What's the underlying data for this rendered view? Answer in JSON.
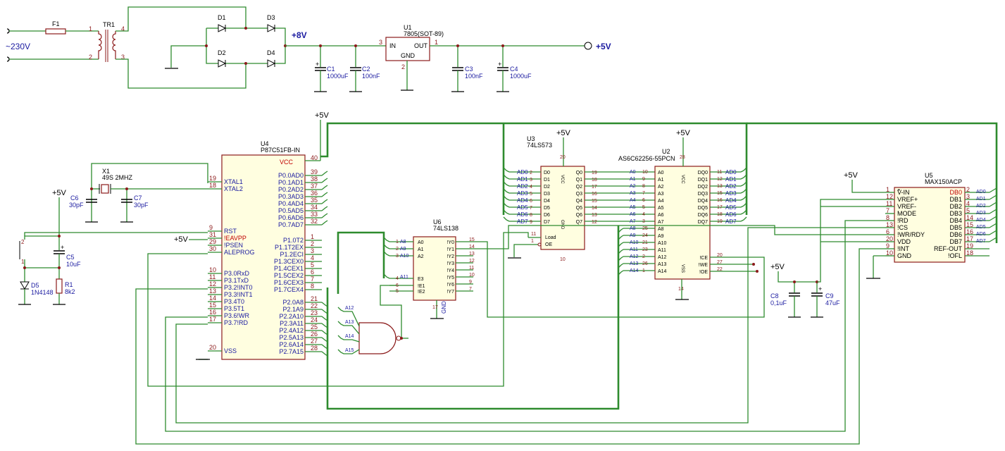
{
  "power": {
    "mains": "~230V",
    "fuse": "F1",
    "transformer": "TR1",
    "tr_pins": [
      "1",
      "2",
      "4",
      "3"
    ],
    "diodes": [
      "D1",
      "D2",
      "D3",
      "D4"
    ],
    "rail8": "+8V",
    "reg_ref": "U1",
    "reg_value": "7805(SOT-89)",
    "reg_in": "IN",
    "reg_out": "OUT",
    "reg_gnd": "GND",
    "reg_pin_in": "3",
    "reg_pin_out": "1",
    "reg_pin_gnd": "2",
    "rail5": "+5V",
    "c1_ref": "C1",
    "c1_val": "1000uF",
    "c2_ref": "C2",
    "c2_val": "100nF",
    "c3_ref": "C3",
    "c3_val": "100nF",
    "c4_ref": "C4",
    "c4_val": "1000uF"
  },
  "mcu": {
    "ref": "U4",
    "value": "P87C51FB-IN",
    "vcc_label": "+5V",
    "left_pins": [
      {
        "n": "19",
        "name": "XTAL1"
      },
      {
        "n": "18",
        "name": "XTAL2"
      },
      {
        "n": "9",
        "name": "RST"
      },
      {
        "n": "31",
        "name": "!EAVPP"
      },
      {
        "n": "29",
        "name": "!PSEN"
      },
      {
        "n": "30",
        "name": "ALEPROG"
      },
      {
        "n": "10",
        "name": "P3.0RxD"
      },
      {
        "n": "11",
        "name": "P3.1TxD"
      },
      {
        "n": "12",
        "name": "P3.2!INT0"
      },
      {
        "n": "13",
        "name": "P3.3!INT1"
      },
      {
        "n": "14",
        "name": "P3.4T0"
      },
      {
        "n": "15",
        "name": "P3.5T1"
      },
      {
        "n": "16",
        "name": "P3.6!WR"
      },
      {
        "n": "17",
        "name": "P3.7!RD"
      },
      {
        "n": "20",
        "name": "VSS"
      }
    ],
    "vcc": {
      "n": "40",
      "name": "VCC"
    },
    "port0": [
      {
        "n": "39",
        "name": "P0.0AD0"
      },
      {
        "n": "38",
        "name": "P0.1AD1"
      },
      {
        "n": "37",
        "name": "P0.2AD2"
      },
      {
        "n": "36",
        "name": "P0.3AD3"
      },
      {
        "n": "35",
        "name": "P0.4AD4"
      },
      {
        "n": "34",
        "name": "P0.5AD5"
      },
      {
        "n": "33",
        "name": "P0.6AD6"
      },
      {
        "n": "32",
        "name": "P0.7AD7"
      }
    ],
    "port1": [
      {
        "n": "1",
        "name": "P1.0T2"
      },
      {
        "n": "2",
        "name": "P1.1T2EX"
      },
      {
        "n": "3",
        "name": "P1.2ECI"
      },
      {
        "n": "4",
        "name": "P1.3CEX0"
      },
      {
        "n": "5",
        "name": "P1.4CEX1"
      },
      {
        "n": "6",
        "name": "P1.5CEX2"
      },
      {
        "n": "7",
        "name": "P1.6CEX3"
      },
      {
        "n": "8",
        "name": "P1.7CEX4"
      }
    ],
    "port2": [
      {
        "n": "21",
        "name": "P2.0A8"
      },
      {
        "n": "22",
        "name": "P2.1A9"
      },
      {
        "n": "23",
        "name": "P2.2A10"
      },
      {
        "n": "24",
        "name": "P2.3A11"
      },
      {
        "n": "25",
        "name": "P2.4A12"
      },
      {
        "n": "26",
        "name": "P2.5A13"
      },
      {
        "n": "27",
        "name": "P2.6A14"
      },
      {
        "n": "28",
        "name": "P2.7A15"
      }
    ]
  },
  "crystal": {
    "ref": "X1",
    "value": "49S 2MHZ",
    "c6_ref": "C6",
    "c6_val": "30pF",
    "c7_ref": "C7",
    "c7_val": "30pF"
  },
  "reset": {
    "vcc": "+5V",
    "eavpp_vcc": "+5V",
    "c5_ref": "C5",
    "c5_val": "10uF",
    "d5_ref": "D5",
    "d5_val": "1N4148",
    "r1_ref": "R1",
    "r1_val": "8k2",
    "sw_pins": [
      "2",
      "1"
    ]
  },
  "latch": {
    "ref": "U3",
    "value": "74LS573",
    "vcc_label": "+5V",
    "inputs": [
      {
        "net": "AD0",
        "n": "2",
        "name": "D0"
      },
      {
        "net": "AD1",
        "n": "3",
        "name": "D1"
      },
      {
        "net": "AD2",
        "n": "4",
        "name": "D2"
      },
      {
        "net": "AD3",
        "n": "5",
        "name": "D3"
      },
      {
        "net": "AD4",
        "n": "6",
        "name": "D4"
      },
      {
        "net": "AD5",
        "n": "7",
        "name": "D5"
      },
      {
        "net": "AD6",
        "n": "8",
        "name": "D6"
      },
      {
        "net": "AD7",
        "n": "9",
        "name": "D7"
      }
    ],
    "outputs": [
      {
        "name": "Q0",
        "n": "19"
      },
      {
        "name": "Q1",
        "n": "18"
      },
      {
        "name": "Q2",
        "n": "17"
      },
      {
        "name": "Q3",
        "n": "16"
      },
      {
        "name": "Q4",
        "n": "15"
      },
      {
        "name": "Q5",
        "n": "14"
      },
      {
        "name": "Q6",
        "n": "13"
      },
      {
        "name": "Q7",
        "n": "12"
      }
    ],
    "load": {
      "n": "11",
      "name": "Load"
    },
    "oe": {
      "n": "1",
      "name": "OE"
    },
    "vcc_pin": "20",
    "vcc_name": "VCC",
    "gnd_pin": "10",
    "gnd_name": "GND"
  },
  "sram": {
    "ref": "U2",
    "value": "AS6C62256-55PCN",
    "vcc_label": "+5V",
    "addr": [
      {
        "net": "A0",
        "n": "10",
        "name": "A0"
      },
      {
        "net": "A1",
        "n": "9",
        "name": "A1"
      },
      {
        "net": "A2",
        "n": "8",
        "name": "A2"
      },
      {
        "net": "A3",
        "n": "7",
        "name": "A3"
      },
      {
        "net": "A4",
        "n": "6",
        "name": "A4"
      },
      {
        "net": "A5",
        "n": "5",
        "name": "A5"
      },
      {
        "net": "A6",
        "n": "4",
        "name": "A6"
      },
      {
        "net": "A7",
        "n": "3",
        "name": "A7"
      },
      {
        "net": "A8",
        "n": "25",
        "name": "A8"
      },
      {
        "net": "A9",
        "n": "24",
        "name": "A9"
      },
      {
        "net": "A10",
        "n": "21",
        "name": "A10"
      },
      {
        "net": "A11",
        "n": "23",
        "name": "A11"
      },
      {
        "net": "A12",
        "n": "2",
        "name": "A12"
      },
      {
        "net": "A13",
        "n": "26",
        "name": "A13"
      },
      {
        "net": "A14",
        "n": "1",
        "name": "A14"
      }
    ],
    "data": [
      {
        "name": "DQ0",
        "n": "11",
        "net": "AD0"
      },
      {
        "name": "DQ1",
        "n": "12",
        "net": "AD1"
      },
      {
        "name": "DQ2",
        "n": "13",
        "net": "AD2"
      },
      {
        "name": "DQ3",
        "n": "15",
        "net": "AD3"
      },
      {
        "name": "DQ4",
        "n": "16",
        "net": "AD4"
      },
      {
        "name": "DQ5",
        "n": "17",
        "net": "AD5"
      },
      {
        "name": "DQ6",
        "n": "18",
        "net": "AD6"
      },
      {
        "name": "DQ7",
        "n": "19",
        "net": "AD7"
      }
    ],
    "ctrl": [
      {
        "name": "!CE",
        "n": "20"
      },
      {
        "name": "!WE",
        "n": "27"
      },
      {
        "name": "!OE",
        "n": "22"
      }
    ],
    "vcc_pin": "28",
    "vcc_name": "VCC",
    "vss_pin": "14",
    "vss_name": "VSS"
  },
  "decoder": {
    "ref": "U6",
    "value": "74LS138",
    "inputs": [
      {
        "net": "A8",
        "n": "1",
        "name": "A0"
      },
      {
        "net": "A9",
        "n": "2",
        "name": "A1"
      },
      {
        "net": "A10",
        "n": "3",
        "name": "A2"
      }
    ],
    "enables": [
      {
        "net": "A11",
        "n": "4",
        "name": "E3"
      },
      {
        "net": "",
        "n": "6",
        "name": "!E1"
      },
      {
        "net": "",
        "n": "5",
        "name": "!E2"
      }
    ],
    "outputs": [
      {
        "name": "!Y0",
        "n": "15"
      },
      {
        "name": "!Y1",
        "n": "14"
      },
      {
        "name": "!Y2",
        "n": "13"
      },
      {
        "name": "!Y3",
        "n": "12"
      },
      {
        "name": "!Y4",
        "n": "11"
      },
      {
        "name": "!Y5",
        "n": "10"
      },
      {
        "name": "!Y6",
        "n": "9"
      },
      {
        "name": "!Y7",
        "n": "7"
      }
    ],
    "gnd_pin": "17",
    "gnd_name": "GND"
  },
  "nand": {
    "inputs": [
      "A12",
      "A13",
      "A14",
      "A15"
    ]
  },
  "adc": {
    "ref": "U5",
    "value": "MAX150ACP",
    "vcc_label": "+5V",
    "left": [
      {
        "n": "1",
        "name": "V-IN"
      },
      {
        "n": "12",
        "name": "VREF+"
      },
      {
        "n": "11",
        "name": "VREF-"
      },
      {
        "n": "7",
        "name": "MODE"
      },
      {
        "n": "8",
        "name": "!RD"
      },
      {
        "n": "13",
        "name": "!CS"
      },
      {
        "n": "6",
        "name": "!WR/RDY"
      },
      {
        "n": "20",
        "name": "VDD"
      },
      {
        "n": "9",
        "name": "!INT"
      },
      {
        "n": "10",
        "name": "GND"
      }
    ],
    "right": [
      {
        "name": "DB0",
        "n": "2",
        "net": "AD0"
      },
      {
        "name": "DB1",
        "n": "3",
        "net": "AD1"
      },
      {
        "name": "DB2",
        "n": "4",
        "net": "AD2"
      },
      {
        "name": "DB3",
        "n": "5",
        "net": "AD3"
      },
      {
        "name": "DB4",
        "n": "14",
        "net": "AD4"
      },
      {
        "name": "DB5",
        "n": "15",
        "net": "AD5"
      },
      {
        "name": "DB6",
        "n": "16",
        "net": "AD6"
      },
      {
        "name": "DB7",
        "n": "17",
        "net": "AD7"
      },
      {
        "name": "REF-OUT",
        "n": "19",
        "net": ""
      },
      {
        "name": "!OFL",
        "n": "18",
        "net": ""
      }
    ],
    "decoupling_vcc": "+5V",
    "c8_ref": "C8",
    "c8_val": "0,1uF",
    "c9_ref": "C9",
    "c9_val": "47uF"
  },
  "colors": {
    "wire": "#2e8b2e",
    "part": "#8b1a1a",
    "label": "#1a1aa0",
    "pin_num": "#8b1a1a",
    "ic_fill": "#fffee0",
    "highlight": "#c00000"
  }
}
